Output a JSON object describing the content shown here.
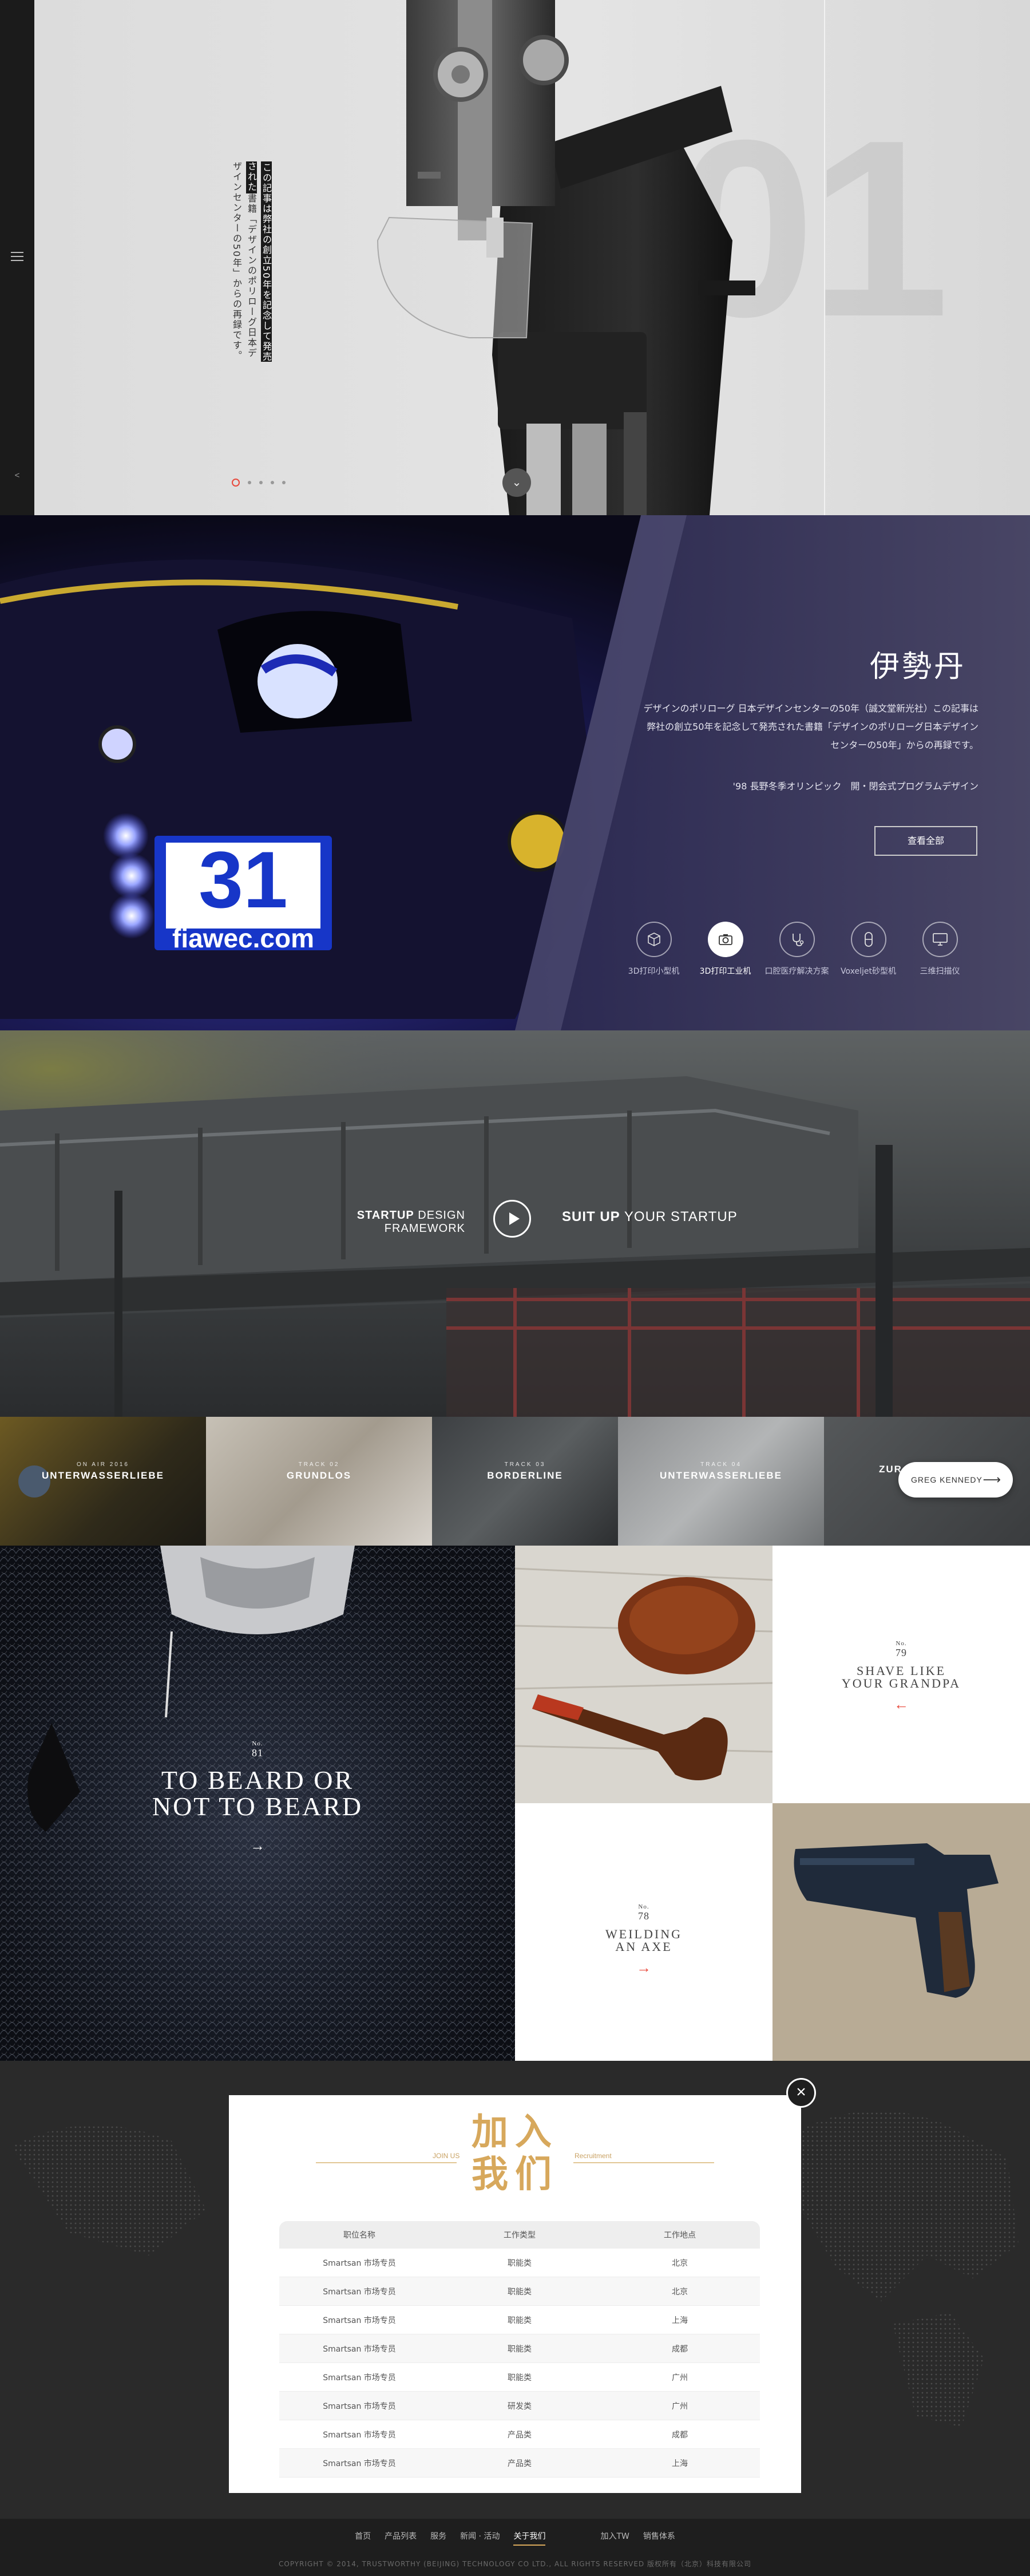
{
  "hero": {
    "number": "01",
    "text_highlight": "この記事は弊社の創立50年を記念して発売された",
    "text_rest": "書籍「デザインのポリローグ日本デザインセンターの50年」からの再録です。",
    "dots": [
      "active",
      "",
      "",
      "",
      ""
    ]
  },
  "race": {
    "title": "伊勢丹",
    "desc": "デザインのポリローグ 日本デザインセンターの50年（誠文堂新光社）この記事は弊社の創立50年を記念して発売された書籍「デザインのポリローグ日本デザインセンターの50年」からの再録です。",
    "desc2": "'98 長野冬季オリンピック　開・閉会式プログラムデザイン",
    "view_all": "查看全部",
    "car_number": "31",
    "car_site": "fiawec.com",
    "categories": [
      {
        "label": "3D打印小型机",
        "icon": "cube-icon"
      },
      {
        "label": "3D打印工业机",
        "icon": "camera-icon"
      },
      {
        "label": "口腔医疗解决方案",
        "icon": "stethoscope-icon"
      },
      {
        "label": "Voxeljet砂型机",
        "icon": "capsule-icon"
      },
      {
        "label": "三维扫描仪",
        "icon": "monitor-icon"
      }
    ],
    "active_category": 1
  },
  "video": {
    "left_bold": "STARTUP",
    "left_rest": " DESIGN FRAMEWORK",
    "right_bold": "SUIT UP",
    "right_rest": " YOUR STARTUP"
  },
  "tracks": {
    "items": [
      {
        "small": "ON AIR 2016",
        "name": "UNTERWASSERLIEBE"
      },
      {
        "small": "TRACK 02",
        "name": "GRUNDLOS"
      },
      {
        "small": "TRACK 03",
        "name": "BORDERLINE"
      },
      {
        "small": "TRACK 04",
        "name": "UNTERWASSERLIEBE"
      },
      {
        "small": "",
        "name": "ZUR"
      }
    ],
    "next_label": "GREG KENNEDY"
  },
  "posts": [
    {
      "no_label": "No.",
      "no": "81",
      "title_1": "TO BEARD OR",
      "title_2": "NOT TO BEARD",
      "arrow": "→"
    },
    {
      "no_label": "No.",
      "no": "79",
      "title_1": "SHAVE LIKE",
      "title_2": "YOUR GRANDPA",
      "arrow": "←"
    },
    {
      "no_label": "No.",
      "no": "78",
      "title_1": "WEILDING",
      "title_2": "AN AXE",
      "arrow": "→"
    }
  ],
  "recruit": {
    "title_1": "加入",
    "title_2": "我们",
    "en_left": "JOIN US",
    "en_right": "Recruitment",
    "close": "×",
    "headers": [
      "职位名称",
      "工作类型",
      "工作地点"
    ],
    "rows": [
      [
        "Smartsan 市场专员",
        "职能类",
        "北京"
      ],
      [
        "Smartsan 市场专员",
        "职能类",
        "北京"
      ],
      [
        "Smartsan 市场专员",
        "职能类",
        "上海"
      ],
      [
        "Smartsan 市场专员",
        "职能类",
        "成都"
      ],
      [
        "Smartsan 市场专员",
        "职能类",
        "广州"
      ],
      [
        "Smartsan 市场专员",
        "研发类",
        "广州"
      ],
      [
        "Smartsan 市场专员",
        "产品类",
        "成都"
      ],
      [
        "Smartsan 市场专员",
        "产品类",
        "上海"
      ]
    ]
  },
  "footer": {
    "nav": [
      "首页",
      "产品列表",
      "服务",
      "新闻 · 活动",
      "关于我们",
      "加入TW",
      "销售体系"
    ],
    "active": 4,
    "copyright": "COPYRIGHT © 2014, TRUSTWORTHY (BEIJING) TECHNOLOGY CO LTD., ALL RIGHTS RESERVED 版权所有（北京）科技有限公司"
  },
  "colors": {
    "accent": "#e8483b",
    "gold": "#d7a85c",
    "dark": "#1b1b1b"
  }
}
